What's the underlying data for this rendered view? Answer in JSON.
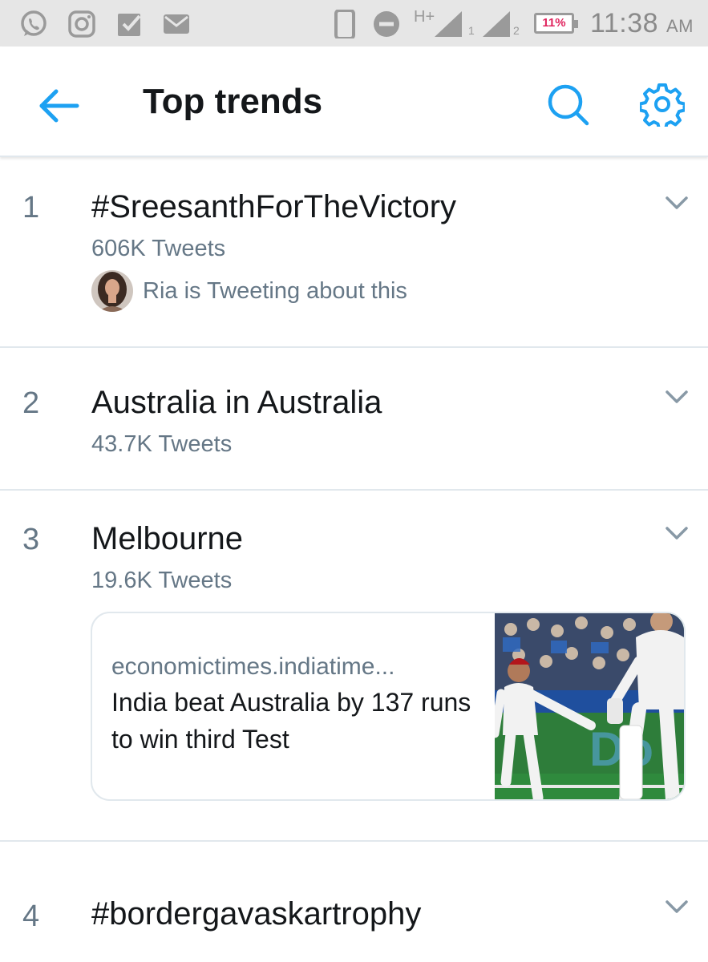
{
  "status_bar": {
    "time": "11:38",
    "ampm": "AM",
    "battery": "11%",
    "network_label": "H+",
    "sim1": "1",
    "sim2": "2",
    "icons": [
      "whatsapp-icon",
      "instagram-icon",
      "check-icon",
      "mail-icon",
      "phone-icon",
      "dnd-icon",
      "signal-icon"
    ]
  },
  "header": {
    "title": "Top trends",
    "back_icon": "arrow-left-icon",
    "search_icon": "search-icon",
    "settings_icon": "gear-icon"
  },
  "colors": {
    "accent": "#1da1f2",
    "text_primary": "#14171a",
    "text_secondary": "#657786",
    "divider": "#e1e8ed"
  },
  "trends": [
    {
      "rank": "1",
      "name": "#SreesanthForTheVictory",
      "count": "606K Tweets",
      "social_context": "Ria is Tweeting about this"
    },
    {
      "rank": "2",
      "name": "Australia in Australia",
      "count": "43.7K Tweets"
    },
    {
      "rank": "3",
      "name": "Melbourne",
      "count": "19.6K Tweets",
      "card": {
        "domain": "economictimes.indiatime...",
        "title": "India beat Australia by 137 runs to win third Test"
      }
    },
    {
      "rank": "4",
      "name": "#bordergavaskartrophy"
    }
  ]
}
